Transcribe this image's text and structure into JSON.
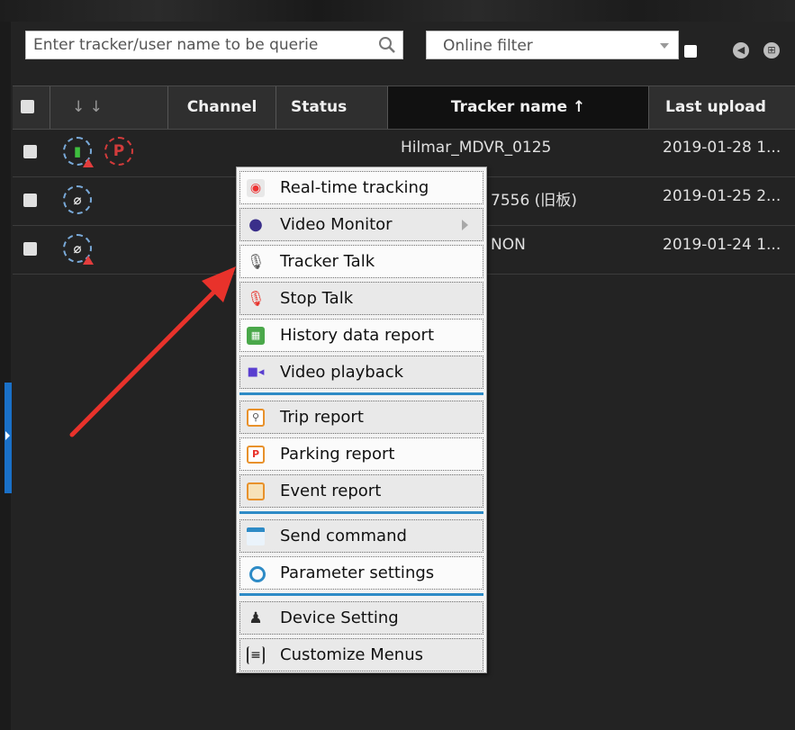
{
  "toolbar": {
    "search_placeholder": "Enter tracker/user name to be querie",
    "filter_value": "Online filter",
    "icons": [
      "search-icon",
      "chevron-down-icon",
      "prev-circle-icon",
      "tree-view-icon"
    ]
  },
  "table": {
    "headers": {
      "sort_arrows": "↓   ↓",
      "channel": "Channel",
      "status": "Status",
      "tracker_name": "Tracker name ↑",
      "last_upload": "Last upload"
    },
    "rows": [
      {
        "tracker_name": "Hilmar_MDVR_0125",
        "last_upload": "2019-01-28 1..."
      },
      {
        "tracker_name": "7556 (旧板)",
        "last_upload": "2019-01-25 2..."
      },
      {
        "tracker_name": "NON",
        "last_upload": "2019-01-24 1..."
      }
    ]
  },
  "context_menu": {
    "items": [
      {
        "label": "Real-time tracking",
        "icon": "map-pin-icon"
      },
      {
        "label": "Video Monitor",
        "icon": "video-monitor-icon"
      },
      {
        "label": "Tracker Talk",
        "icon": "microphone-icon"
      },
      {
        "label": "Stop Talk",
        "icon": "microphone-stop-icon"
      },
      {
        "label": "History data report",
        "icon": "map-report-icon"
      },
      {
        "label": "Video playback",
        "icon": "video-camera-icon"
      },
      {
        "label": "Trip report",
        "icon": "trip-report-icon"
      },
      {
        "label": "Parking report",
        "icon": "parking-report-icon"
      },
      {
        "label": "Event report",
        "icon": "event-report-icon"
      },
      {
        "label": "Send command",
        "icon": "command-window-icon"
      },
      {
        "label": "Parameter settings",
        "icon": "circle-settings-icon"
      },
      {
        "label": "Device Setting",
        "icon": "person-device-icon"
      },
      {
        "label": "Customize Menus",
        "icon": "list-menu-icon"
      }
    ]
  },
  "colors": {
    "background": "#232323",
    "menu_separator": "#2e8bc6",
    "annotation_arrow": "#e8322b",
    "status_blue": "#79a9d8",
    "status_red": "#d23b3b"
  }
}
